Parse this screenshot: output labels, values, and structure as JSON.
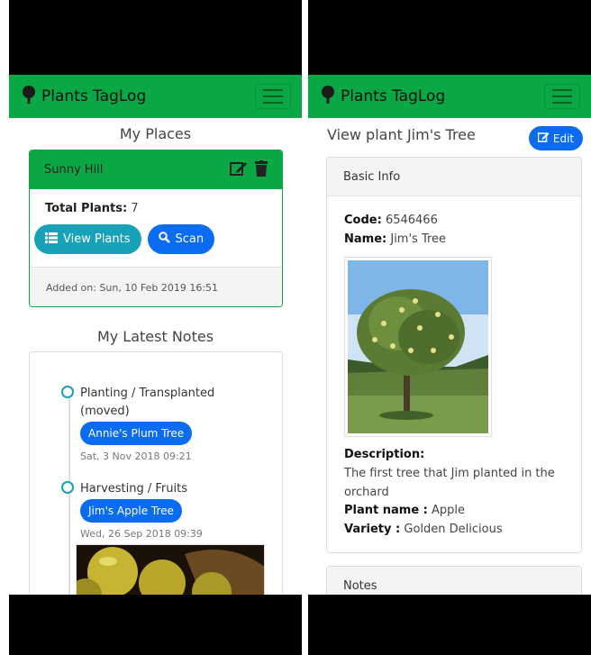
{
  "app": {
    "brand": "Plants TagLog"
  },
  "left": {
    "places_title": "My Places",
    "place": {
      "name": "Sunny Hill",
      "total_label": "Total Plants:",
      "total_value": "7",
      "view_plants_label": "View Plants",
      "scan_label": "Scan",
      "added_on": "Added on: Sun, 10 Feb 2019 16:51"
    },
    "notes_title": "My Latest Notes",
    "notes": [
      {
        "title_line1": "Planting / Transplanted",
        "title_line2": "(moved)",
        "plant": "Annie's Plum Tree",
        "date": "Sat, 3 Nov 2018 09:21"
      },
      {
        "title_line1": "Harvesting / Fruits",
        "plant": "Jim's Apple Tree",
        "date": "Wed, 26 Sep 2018 09:39"
      }
    ]
  },
  "right": {
    "title": "View plant Jim's Tree",
    "edit_label": "Edit",
    "basic_info_header": "Basic Info",
    "code_label": "Code:",
    "code_value": "6546466",
    "name_label": "Name:",
    "name_value": "Jim's Tree",
    "description_label": "Description:",
    "description_line1": "The first tree that Jim planted in the",
    "description_line2": "orchard",
    "plant_name_label": "Plant name :",
    "plant_name_value": "Apple",
    "variety_label": "Variety :",
    "variety_value": "Golden Delicious",
    "notes_header": "Notes"
  },
  "colors": {
    "brand_green": "#0aa844",
    "primary_blue": "#0a6cf0",
    "info_teal": "#17a2b8"
  },
  "icons": [
    "tree-logo-icon",
    "hamburger-icon",
    "edit-icon",
    "trash-icon",
    "list-icon",
    "search-icon",
    "timeline-dot-icon"
  ]
}
